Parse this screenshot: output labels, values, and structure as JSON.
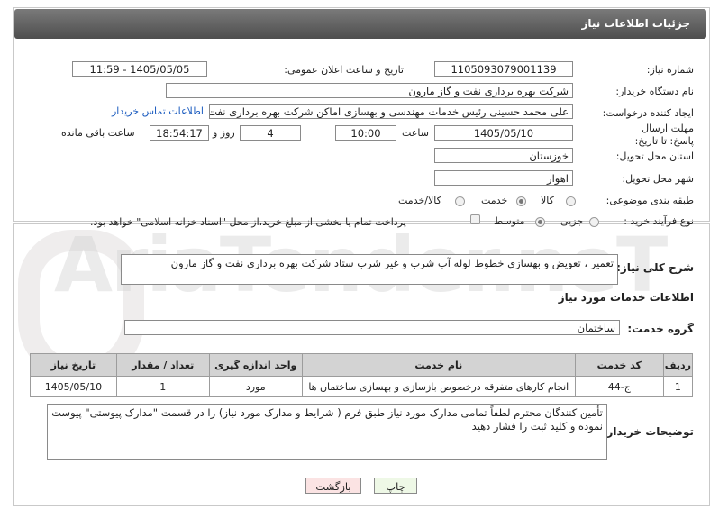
{
  "header": {
    "title": "جزئیات اطلاعات نیاز"
  },
  "form": {
    "need_number_label": "شماره نیاز:",
    "need_number": "1105093079001139",
    "announce_label": "تاریخ و ساعت اعلان عمومی:",
    "announce_value": "1405/05/05 - 11:59",
    "buyer_org_label": "نام دستگاه خریدار:",
    "buyer_org": "شرکت بهره برداری نفت و گاز مارون",
    "requester_label": "ایجاد کننده درخواست:",
    "requester": "علی محمد حسینی رئیس خدمات مهندسی و بهسازی اماکن شرکت بهره برداری نفت و گاز مارون",
    "contact_link": "اطلاعات تماس خریدار",
    "deadline_label": "مهلت ارسال پاسخ: تا تاریخ:",
    "deadline_date": "1405/05/10",
    "time_label": "ساعت",
    "deadline_time": "10:00",
    "days_value": "4",
    "days_label": "روز و",
    "remaining_time": "18:54:17",
    "remaining_label": "ساعت باقی مانده",
    "province_label": "استان محل تحویل:",
    "province": "خوزستان",
    "city_label": "شهر محل تحویل:",
    "city": "اهواز",
    "category_label": "طبقه بندی موضوعی:",
    "category_options": [
      "کالا",
      "خدمت",
      "کالا/خدمت"
    ],
    "category_selected": "خدمت",
    "process_label": "نوع فرآیند خرید :",
    "process_options": [
      "جزیی",
      "متوسط"
    ],
    "process_selected": "متوسط",
    "payment_note": "پرداخت تمام یا بخشی از مبلغ خرید،از محل \"اسناد خزانه اسلامی\" خواهد بود."
  },
  "summary": {
    "label": "شرح کلی نیاز:",
    "text": "تعمیر ، تعویض و بهسازی خطوط لوله آب شرب و غیر شرب ستاد شرکت بهره برداری نفت و گاز مارون"
  },
  "services": {
    "section_title": "اطلاعات خدمات مورد نیاز",
    "group_label": "گروه خدمت:",
    "group_value": "ساختمان",
    "columns": [
      "ردیف",
      "کد خدمت",
      "نام خدمت",
      "واحد اندازه گیری",
      "تعداد / مقدار",
      "تاریخ نیاز"
    ],
    "rows": [
      [
        "1",
        "ج-44",
        "انجام کارهای متفرقه درخصوص بازسازی و بهسازی ساختمان ها",
        "مورد",
        "1",
        "1405/05/10"
      ]
    ]
  },
  "notes": {
    "label": "توضیحات خریدار:",
    "text": "تأمین کنندگان محترم لطفاً تمامی مدارک مورد نیاز طبق فرم ( شرایط و مدارک مورد نیاز) را در قسمت \"مدارک پیوستی\" پیوست نموده و کلید ثبت را فشار دهید"
  },
  "buttons": {
    "print": "چاپ",
    "back": "بازگشت"
  },
  "watermark": "AriaTender.neT",
  "colors": {
    "header": "#5f5f5f",
    "print_bg": "#eef8e6",
    "back_bg": "#fbe3e3",
    "link": "#1a5bbf"
  }
}
